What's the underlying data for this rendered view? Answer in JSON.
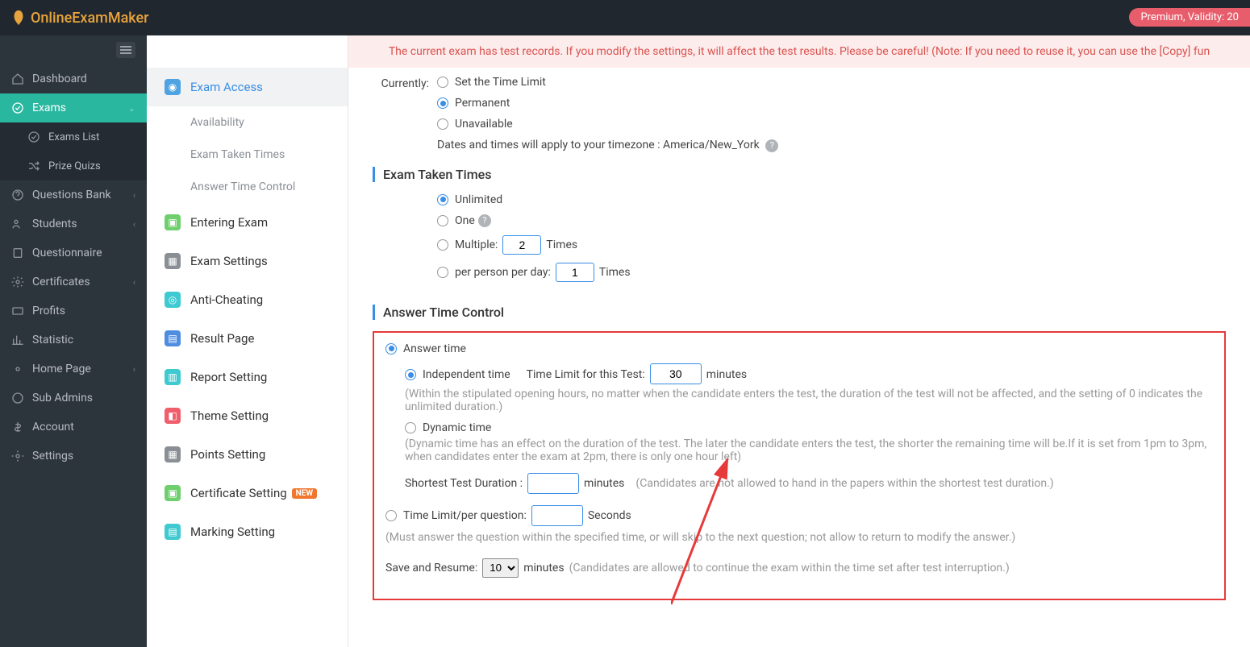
{
  "brand": "OnlineExamMaker",
  "premium": "Premium, Validity: 20",
  "warning": "The current exam has test records. If you modify the settings, it will affect the test results. Please be careful! (Note: If you need to reuse it, you can use the [Copy] fun",
  "nav": {
    "dashboard": "Dashboard",
    "exams": "Exams",
    "exams_list": "Exams List",
    "prize_quizs": "Prize Quizs",
    "questions_bank": "Questions Bank",
    "students": "Students",
    "questionnaire": "Questionnaire",
    "certificates": "Certificates",
    "profits": "Profits",
    "statistic": "Statistic",
    "home_page": "Home Page",
    "sub_admins": "Sub Admins",
    "account": "Account",
    "settings": "Settings"
  },
  "subpanel": {
    "exam_access": "Exam Access",
    "availability": "Availability",
    "exam_taken_times": "Exam Taken Times",
    "answer_time_control": "Answer Time Control",
    "entering_exam": "Entering Exam",
    "exam_settings": "Exam Settings",
    "anti_cheating": "Anti-Cheating",
    "result_page": "Result Page",
    "report_setting": "Report Setting",
    "theme_setting": "Theme Setting",
    "points_setting": "Points Setting",
    "certificate_setting": "Certificate Setting",
    "new_badge": "NEW",
    "marking_setting": "Marking Setting"
  },
  "currently": {
    "label": "Currently:",
    "set_time_limit": "Set the Time Limit",
    "permanent": "Permanent",
    "unavailable": "Unavailable",
    "timezone_note": "Dates and times will apply to your timezone : America/New_York"
  },
  "taken": {
    "title": "Exam Taken Times",
    "unlimited": "Unlimited",
    "one": "One",
    "multiple": "Multiple:",
    "multiple_value": "2",
    "times": "Times",
    "per_person": "per person per day:",
    "per_person_value": "1"
  },
  "answer": {
    "title": "Answer Time Control",
    "answer_time": "Answer time",
    "independent_time": "Independent time",
    "time_limit_label": "Time Limit for this Test:",
    "time_limit_value": "30",
    "minutes": "minutes",
    "independent_hint": "(Within the stipulated opening hours, no matter when the candidate enters the test, the duration of the test will not be affected, and the setting of 0 indicates the unlimited duration.)",
    "dynamic_time": "Dynamic time",
    "dynamic_hint": "(Dynamic time has an effect on the duration of the test. The later the candidate enters the test, the shorter the remaining time will be.If it is set from 1pm to 3pm, when candidates enter the exam at 2pm, there is only one hour left)",
    "shortest_label": "Shortest Test Duration :",
    "shortest_hint": "(Candidates are not allowed to hand in the papers within the shortest test duration.)",
    "per_question_label": "Time Limit/per question:",
    "seconds": "Seconds",
    "per_question_hint": "(Must answer the question within the specified time, or will skip to the next question; not allow to return to modify the answer.)",
    "save_resume_label": "Save and Resume:",
    "save_resume_value": "10",
    "save_resume_hint": "(Candidates are allowed to continue the exam within the time set after test interruption.)"
  },
  "colors": {
    "accent_teal": "#2ab7a0",
    "accent_blue": "#3a8ee6",
    "sidebar_bg": "#2d353c",
    "danger": "#e63a3a",
    "orange": "#f0762d"
  }
}
